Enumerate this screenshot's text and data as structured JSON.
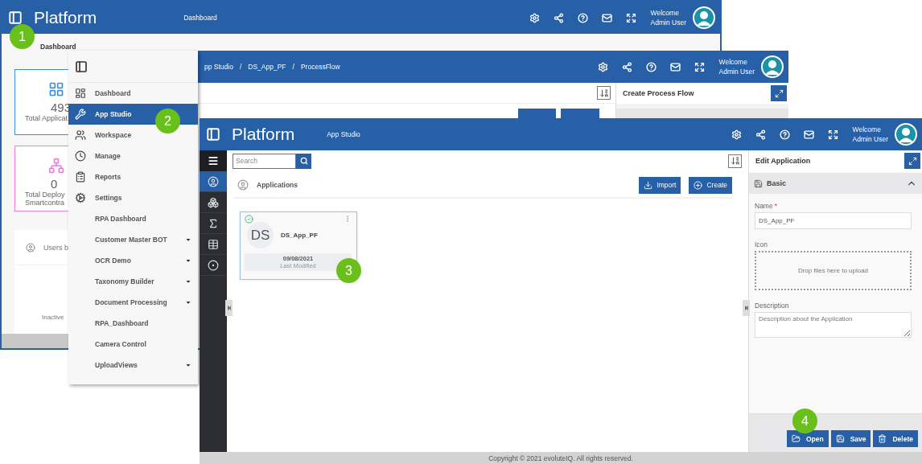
{
  "dashboard_window": {
    "header": {
      "app_name": "Platform",
      "page": "Dashboard",
      "welcome": "Welcome",
      "user": "Admin User"
    },
    "breadcrumb": "Dashboard",
    "stat_cards": [
      {
        "value": "493",
        "label_lines": [
          "Total Applicat"
        ],
        "color": "#3a8fd9"
      },
      {
        "value": "0",
        "label_lines": [
          "Total Deploy",
          "Smartcontra"
        ],
        "color": "#f07ce0"
      }
    ],
    "users_card": {
      "title": "Users b",
      "chart_label": "Inactive"
    }
  },
  "process_flow_window": {
    "breadcrumb": [
      "pp Studio",
      "DS_App_PF",
      "ProcessFlow"
    ],
    "breadcrumb_separator": "/",
    "welcome": "Welcome",
    "user": "Admin User",
    "panel_title": "Create Process Flow"
  },
  "nav_menu": {
    "items": [
      {
        "label": "Dashboard",
        "selected": false,
        "submenu": false
      },
      {
        "label": "App Studio",
        "selected": true,
        "submenu": false
      },
      {
        "label": "Workspace",
        "selected": false,
        "submenu": false
      },
      {
        "label": "Manage",
        "selected": false,
        "submenu": false
      },
      {
        "label": "Reports",
        "selected": false,
        "submenu": false
      },
      {
        "label": "Settings",
        "selected": false,
        "submenu": false
      },
      {
        "label": "RPA Dashboard",
        "selected": false,
        "submenu": false
      },
      {
        "label": "Customer Master BOT",
        "selected": false,
        "submenu": true
      },
      {
        "label": "OCR Demo",
        "selected": false,
        "submenu": true
      },
      {
        "label": "Taxonomy Builder",
        "selected": false,
        "submenu": true
      },
      {
        "label": "Document Processing",
        "selected": false,
        "submenu": true
      },
      {
        "label": "RPA_Dashboard",
        "selected": false,
        "submenu": false
      },
      {
        "label": "Camera Control",
        "selected": false,
        "submenu": false
      },
      {
        "label": "UploadViews",
        "selected": false,
        "submenu": true
      }
    ]
  },
  "app_studio_window": {
    "header": {
      "app_name": "Platform",
      "page": "App Studio",
      "welcome": "Welcome",
      "user": "Admin User"
    },
    "sidebar": [
      {
        "selected": true
      },
      {
        "selected": false
      },
      {
        "selected": false
      },
      {
        "selected": false
      },
      {
        "selected": false
      }
    ],
    "search": {
      "placeholder": "Search"
    },
    "section_title": "Applications",
    "actions": [
      "Import",
      "Create"
    ],
    "apps": [
      {
        "initials": "DS",
        "name": "DS_App_PF",
        "date": "09/08/2021",
        "date_label": "Last Modified",
        "published": true
      }
    ],
    "edit_panel": {
      "title": "Edit Application",
      "section": {
        "title": "Basic",
        "expanded": true
      },
      "name_field": {
        "label": "Name",
        "required_mark": "*",
        "value": "DS_App_PF"
      },
      "icon_field": {
        "label": "Icon",
        "drop_text": "Drop files here to upload"
      },
      "description_field": {
        "label": "Description",
        "placeholder": "Description about the Application"
      },
      "buttons": [
        "Open",
        "Save",
        "Delete"
      ]
    },
    "footer": "Copyright © 2021 evoluteIQ. All rights reserved."
  },
  "callouts": [
    "1",
    "2",
    "3",
    "4"
  ]
}
